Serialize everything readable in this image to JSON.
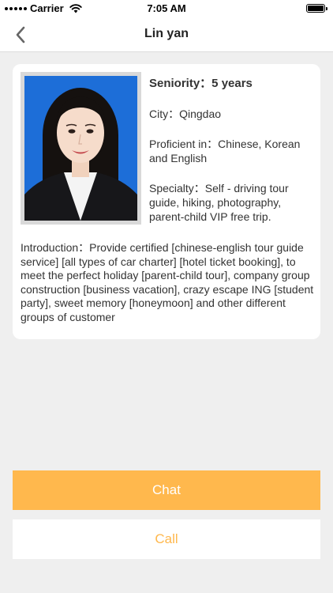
{
  "status_bar": {
    "carrier": "Carrier",
    "time": "7:05 AM",
    "battery_level": 1.0
  },
  "nav": {
    "title": "Lin yan",
    "back_icon": "chevron-left-icon"
  },
  "profile": {
    "seniority": "Seniority：5 years",
    "city": "City：Qingdao",
    "proficient": "Proficient in：Chinese, Korean and English",
    "specialty": "Specialty：Self - driving tour guide, hiking, photography, parent-child VIP free trip.",
    "introduction": "Introduction：Provide certified [chinese-english tour guide service] [all types of car charter] [hotel ticket booking], to meet the perfect holiday [parent-child tour], company group construction [business vacation], crazy escape ING [student party], sweet memory [honeymoon] and other different groups of customer"
  },
  "actions": {
    "chat_label": "Chat",
    "call_label": "Call"
  },
  "colors": {
    "accent": "#ffb84d",
    "photo_background": "#1d6ed8",
    "page_background": "#efefef"
  }
}
